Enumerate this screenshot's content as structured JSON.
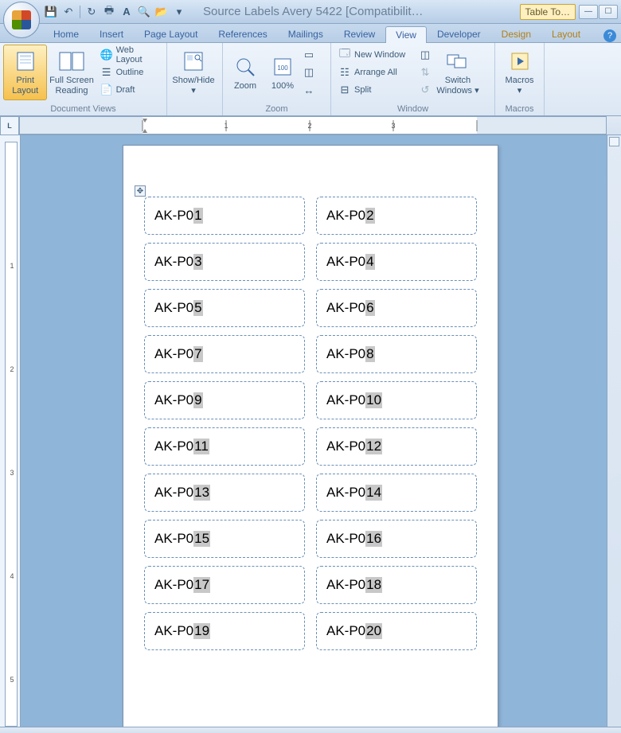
{
  "title": "Source Labels Avery 5422 [Compatibilit…",
  "table_tools": "Table To…",
  "qat": [
    "save",
    "undo",
    "redo",
    "print",
    "spell",
    "lookup",
    "open",
    "list"
  ],
  "tabs": {
    "home": "Home",
    "insert": "Insert",
    "page_layout": "Page Layout",
    "references": "References",
    "mailings": "Mailings",
    "review": "Review",
    "view": "View",
    "developer": "Developer",
    "design": "Design",
    "layout": "Layout"
  },
  "active_tab": "view",
  "ribbon": {
    "doc_views": {
      "print_layout": "Print\nLayout",
      "full_screen": "Full Screen\nReading",
      "web_layout": "Web Layout",
      "outline": "Outline",
      "draft": "Draft",
      "group_label": "Document Views"
    },
    "show_hide": {
      "label": "Show/Hide",
      "group_label": "…"
    },
    "zoom": {
      "zoom": "Zoom",
      "hundred": "100%",
      "group_label": "Zoom"
    },
    "window": {
      "new_window": "New Window",
      "arrange_all": "Arrange All",
      "split": "Split",
      "switch_windows": "Switch\nWindows",
      "group_label": "Window"
    },
    "macros": {
      "macros": "Macros",
      "group_label": "Macros"
    }
  },
  "ruler_corner": "L",
  "labels": [
    {
      "prefix": "AK-P0",
      "suffix": "1"
    },
    {
      "prefix": "AK-P0",
      "suffix": "2"
    },
    {
      "prefix": "AK-P0",
      "suffix": "3"
    },
    {
      "prefix": "AK-P0",
      "suffix": "4"
    },
    {
      "prefix": "AK-P0",
      "suffix": "5"
    },
    {
      "prefix": "AK-P0",
      "suffix": "6"
    },
    {
      "prefix": "AK-P0",
      "suffix": "7"
    },
    {
      "prefix": "AK-P0",
      "suffix": "8"
    },
    {
      "prefix": "AK-P0",
      "suffix": "9"
    },
    {
      "prefix": "AK-P0",
      "suffix": "10"
    },
    {
      "prefix": "AK-P0",
      "suffix": "11"
    },
    {
      "prefix": "AK-P0",
      "suffix": "12"
    },
    {
      "prefix": "AK-P0",
      "suffix": "13"
    },
    {
      "prefix": "AK-P0",
      "suffix": "14"
    },
    {
      "prefix": "AK-P0",
      "suffix": "15"
    },
    {
      "prefix": "AK-P0",
      "suffix": "16"
    },
    {
      "prefix": "AK-P0",
      "suffix": "17"
    },
    {
      "prefix": "AK-P0",
      "suffix": "18"
    },
    {
      "prefix": "AK-P0",
      "suffix": "19"
    },
    {
      "prefix": "AK-P0",
      "suffix": "20"
    }
  ],
  "vruler_marks": [
    "1",
    "2",
    "3",
    "4",
    "5"
  ]
}
